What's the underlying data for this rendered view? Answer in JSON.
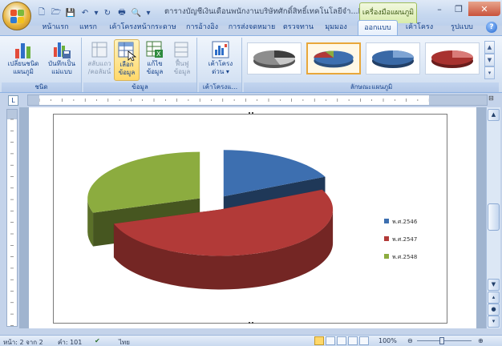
{
  "window": {
    "title": "ตารางบัญชีเงินเดือนพนักงานบริษัทศักดิ์สิทธิ์เทคโนโลยีจำ...M",
    "contextual_tab_title": "เครื่องมือแผนภูมิ"
  },
  "tabs": [
    {
      "label": "หน้าแรก",
      "active": false
    },
    {
      "label": "แทรก",
      "active": false
    },
    {
      "label": "เค้าโครงหน้ากระดาษ",
      "active": false
    },
    {
      "label": "การอ้างอิง",
      "active": false
    },
    {
      "label": "การส่งจดหมาย",
      "active": false
    },
    {
      "label": "ตรวจทาน",
      "active": false
    },
    {
      "label": "มุมมอง",
      "active": false
    },
    {
      "label": "ออกแบบ",
      "active": true
    },
    {
      "label": "เค้าโครง",
      "active": false
    },
    {
      "label": "รูปแบบ",
      "active": false
    }
  ],
  "ribbon": {
    "group_type": {
      "label": "ชนิด",
      "change_chart_type": [
        "เปลี่ยนชนิด",
        "แผนภูมิ"
      ],
      "save_template": [
        "บันทึกเป็น",
        "แม่แบบ"
      ]
    },
    "group_data": {
      "label": "ข้อมูล",
      "switch_row_col": [
        "สลับแถว",
        "/คอลัมน์"
      ],
      "select_data": [
        "เลือก",
        "ข้อมูล"
      ],
      "edit_data": [
        "แก้ไข",
        "ข้อมูล"
      ],
      "refresh_data": [
        "ฟื้นฟู",
        "ข้อมูล"
      ]
    },
    "group_layout": {
      "label": "เค้าโครงแ...",
      "quick_layout": [
        "เค้าโครง",
        "ด่วน ▾"
      ]
    },
    "group_styles": {
      "label": "ลักษณะแผนภูมิ"
    }
  },
  "chart_data": {
    "type": "pie",
    "style": "3d-exploded",
    "series": [
      {
        "name": "พ.ศ.2546",
        "color": "#3d6fb0",
        "value": 18
      },
      {
        "name": "พ.ศ.2547",
        "color": "#b23a38",
        "value": 52
      },
      {
        "name": "พ.ศ.2548",
        "color": "#8cac3f",
        "value": 30
      }
    ],
    "legend_position": "right"
  },
  "statusbar": {
    "page": "หน้า: 2 จาก 2",
    "words": "คำ: 101",
    "language": "ไทย",
    "zoom": "100%"
  },
  "colors": {
    "accent": "#15428b",
    "contextual": "#9dbd5a",
    "selected": "#e8a73a"
  }
}
